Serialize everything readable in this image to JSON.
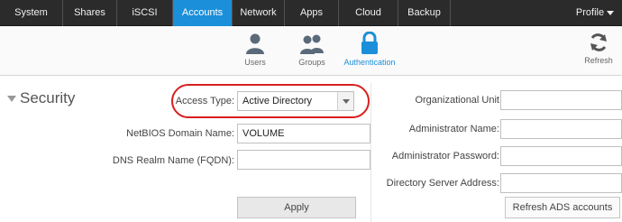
{
  "nav": {
    "tabs": [
      {
        "label": "System"
      },
      {
        "label": "Shares"
      },
      {
        "label": "iSCSI"
      },
      {
        "label": "Accounts",
        "active": true
      },
      {
        "label": "Network"
      },
      {
        "label": "Apps"
      },
      {
        "label": "Cloud"
      },
      {
        "label": "Backup"
      }
    ],
    "profile_label": "Profile"
  },
  "subnav": {
    "items": [
      {
        "label": "Users",
        "icon": "user-icon"
      },
      {
        "label": "Groups",
        "icon": "group-icon"
      },
      {
        "label": "Authentication",
        "icon": "lock-icon",
        "active": true
      }
    ],
    "refresh_label": "Refresh"
  },
  "security": {
    "title": "Security",
    "access_type": {
      "label": "Access Type:",
      "value": "Active Directory"
    },
    "netbios": {
      "label": "NetBIOS Domain Name:",
      "value": "VOLUME"
    },
    "dns_realm": {
      "label": "DNS Realm Name (FQDN):",
      "value": ""
    },
    "org_unit": {
      "label": "Organizational Unit",
      "value": ""
    },
    "admin_name": {
      "label": "Administrator Name:",
      "value": ""
    },
    "admin_password": {
      "label": "Administrator Password:",
      "value": ""
    },
    "dir_server": {
      "label": "Directory Server Address:",
      "value": ""
    },
    "apply_label": "Apply",
    "refresh_ads_label": "Refresh ADS accounts"
  },
  "colors": {
    "nav_bg": "#2b2b2b",
    "accent": "#1b8fd9",
    "highlight": "#d81f1f"
  }
}
